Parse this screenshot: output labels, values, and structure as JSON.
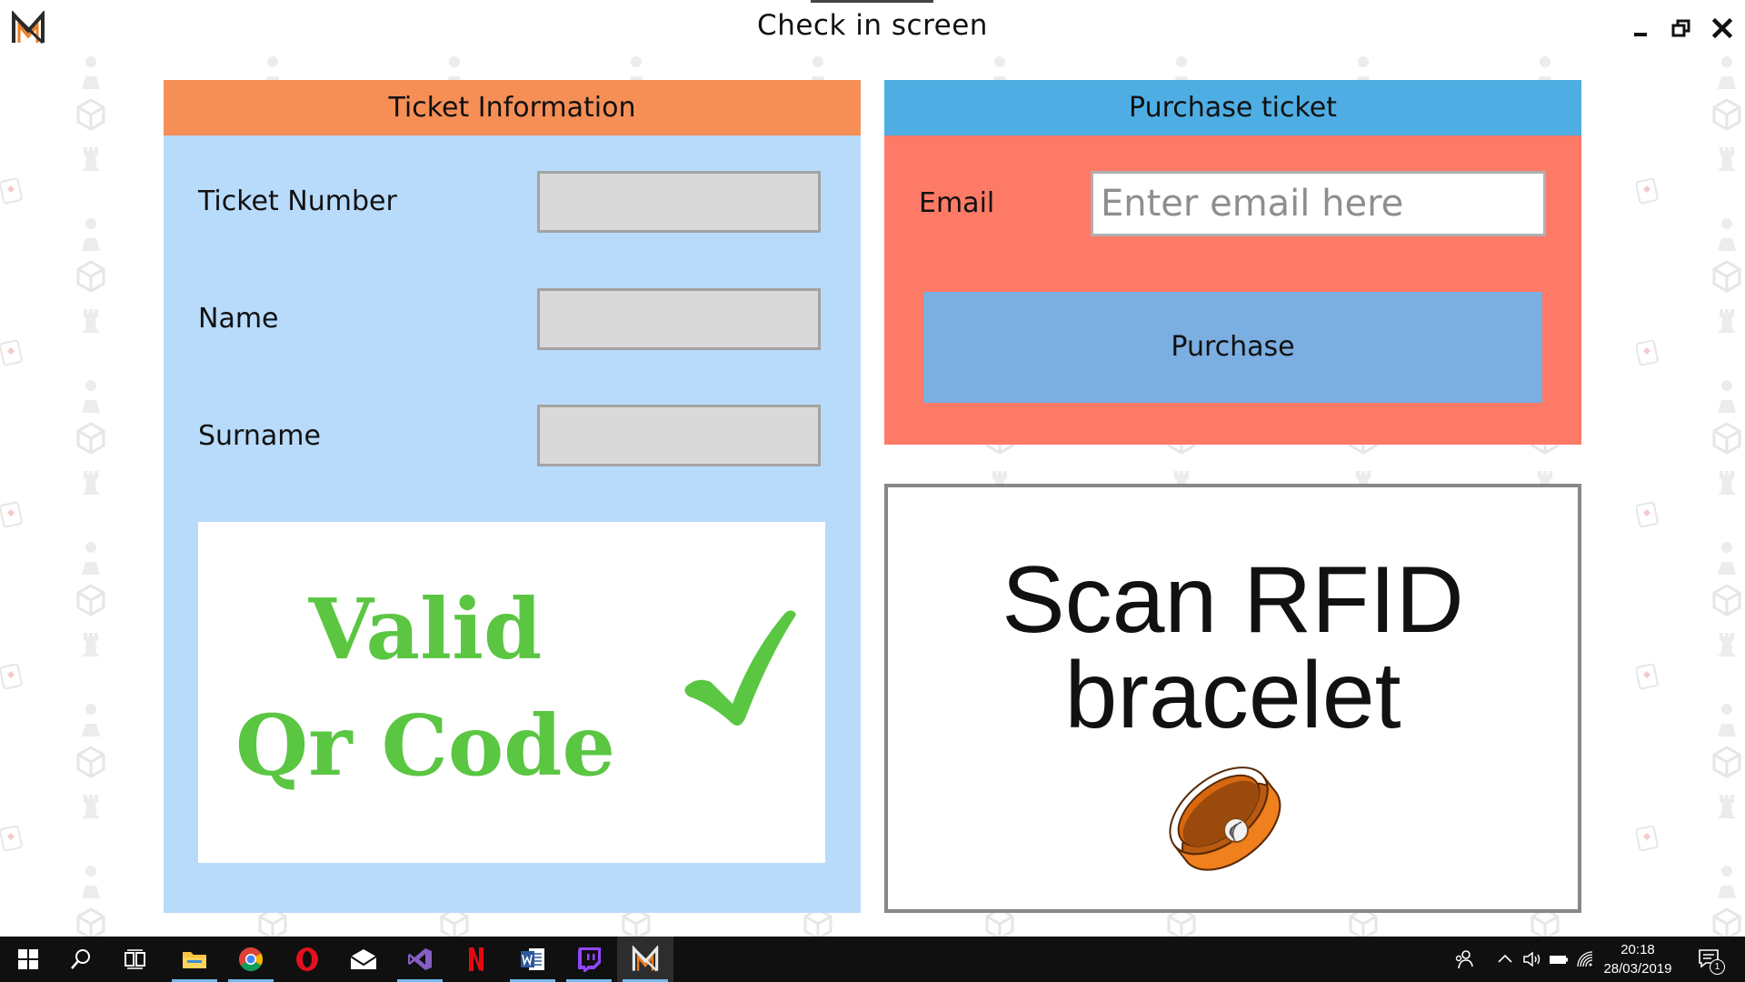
{
  "window": {
    "title": "Check in screen",
    "controls": [
      "minimize",
      "restore",
      "close"
    ]
  },
  "ticket_info": {
    "header": "Ticket Information",
    "header_color": "#f58f56",
    "panel_color": "#b8dbfb",
    "fields": [
      {
        "label": "Ticket Number",
        "value": ""
      },
      {
        "label": "Name",
        "value": ""
      },
      {
        "label": "Surname",
        "value": ""
      }
    ],
    "qr_status": {
      "line1": "Valid",
      "line2": "Qr Code",
      "color": "#5ac642",
      "icon": "checkmark-icon"
    }
  },
  "purchase": {
    "header": "Purchase ticket",
    "header_color": "#4eaee3",
    "panel_color": "#fd7a66",
    "email_label": "Email",
    "email_placeholder": "Enter email here",
    "email_value": "",
    "button_label": "Purchase",
    "button_color": "#7baee1"
  },
  "rfid": {
    "line1": "Scan RFID",
    "line2": "bracelet",
    "icon": "rfid-bracelet-icon",
    "bracelet_color": "#f07f1e"
  },
  "taskbar": {
    "apps": [
      "windows-start-icon",
      "search-icon",
      "task-view-icon",
      "file-explorer-icon",
      "chrome-icon",
      "opera-icon",
      "mail-icon",
      "visual-studio-icon",
      "netflix-icon",
      "word-icon",
      "twitch-icon",
      "app-logo-icon"
    ],
    "time": "20:18",
    "date": "28/03/2019",
    "notification_count": "1"
  }
}
